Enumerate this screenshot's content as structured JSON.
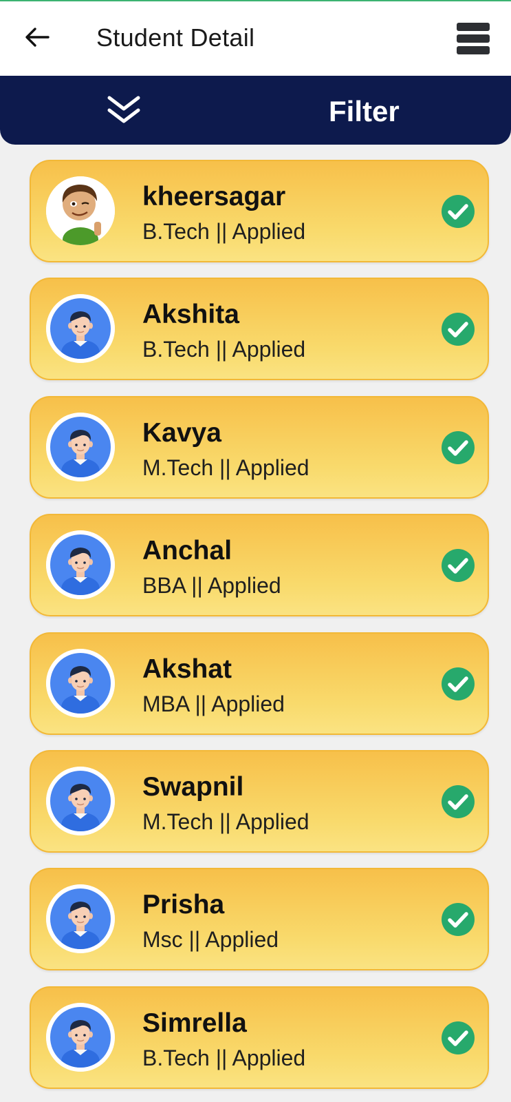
{
  "header": {
    "title": "Student Detail",
    "back_icon": "arrow-left-icon",
    "menu_icon": "menu-icon"
  },
  "filter_bar": {
    "label": "Filter",
    "expand_icon": "double-chevron-down-icon"
  },
  "colors": {
    "header_bg": "#ffffff",
    "filter_bg": "#0d1a4d",
    "card_gradient_top": "#f7c04a",
    "card_gradient_bottom": "#fae382",
    "status_green": "#27a96c",
    "page_bg": "#f0f0f0"
  },
  "students": [
    {
      "name": "kheersagar",
      "course": "B.Tech || Applied",
      "avatar": "cartoon-boy-avatar",
      "status_icon": "check-circle-icon"
    },
    {
      "name": "Akshita",
      "course": "B.Tech || Applied",
      "avatar": "default-user-avatar",
      "status_icon": "check-circle-icon"
    },
    {
      "name": "Kavya",
      "course": "M.Tech || Applied",
      "avatar": "default-user-avatar",
      "status_icon": "check-circle-icon"
    },
    {
      "name": "Anchal",
      "course": "BBA || Applied",
      "avatar": "default-user-avatar",
      "status_icon": "check-circle-icon"
    },
    {
      "name": "Akshat",
      "course": "MBA || Applied",
      "avatar": "default-user-avatar",
      "status_icon": "check-circle-icon"
    },
    {
      "name": "Swapnil",
      "course": "M.Tech || Applied",
      "avatar": "default-user-avatar",
      "status_icon": "check-circle-icon"
    },
    {
      "name": "Prisha",
      "course": "Msc || Applied",
      "avatar": "default-user-avatar",
      "status_icon": "check-circle-icon"
    },
    {
      "name": "Simrella",
      "course": "B.Tech || Applied",
      "avatar": "default-user-avatar",
      "status_icon": "check-circle-icon"
    }
  ]
}
